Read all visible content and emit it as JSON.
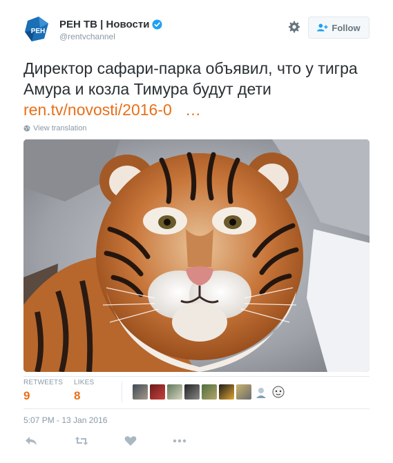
{
  "header": {
    "display_name": "РЕН ТВ | Новости",
    "handle": "@rentvchannel",
    "follow_label": "Follow",
    "avatar_text": "РЕН"
  },
  "tweet": {
    "text": "Директор сафари-парка объявил, что у тигра Амура и козла Тимура будут дети",
    "link": "ren.tv/novosti/2016-0   …",
    "view_translation": "View translation"
  },
  "stats": {
    "retweets_label": "RETWEETS",
    "retweets_value": "9",
    "likes_label": "LIKES",
    "likes_value": "8"
  },
  "timestamp": "5:07 PM - 13 Jan 2016",
  "colors": {
    "link": "#e86f18",
    "muted": "#8899a6",
    "verified": "#1da1f2",
    "brand": "#1a6fb5"
  },
  "icons": {
    "settings": "gear-icon",
    "follow": "add-user-icon",
    "verified": "verified-badge-icon",
    "translate": "globe-icon",
    "reply": "reply-icon",
    "retweet": "retweet-icon",
    "like": "heart-icon",
    "more": "more-icon"
  }
}
